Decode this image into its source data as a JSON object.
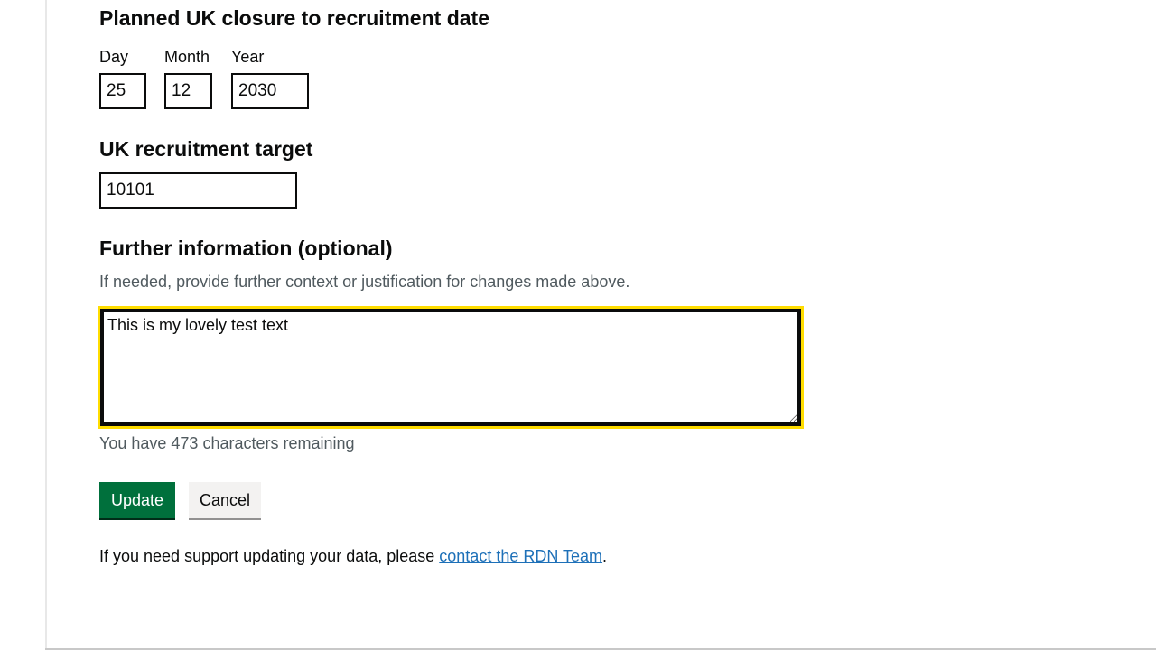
{
  "closure_date": {
    "heading": "Planned UK closure to recruitment date",
    "day_label": "Day",
    "day_value": "25",
    "month_label": "Month",
    "month_value": "12",
    "year_label": "Year",
    "year_value": "2030"
  },
  "recruitment_target": {
    "heading": "UK recruitment target",
    "value": "10101"
  },
  "further_info": {
    "heading": "Further information (optional)",
    "hint": "If needed, provide further context or justification for changes made above.",
    "value": "This is my lovely test text",
    "remaining": "You have 473 characters remaining"
  },
  "actions": {
    "update_label": "Update",
    "cancel_label": "Cancel"
  },
  "support": {
    "prefix": "If you need support updating your data, please ",
    "link_text": "contact the RDN Team",
    "suffix": "."
  },
  "colors": {
    "focus": "#ffdd00",
    "primary_button": "#00703c",
    "link": "#1d70b8",
    "hint_text": "#505a5f"
  }
}
